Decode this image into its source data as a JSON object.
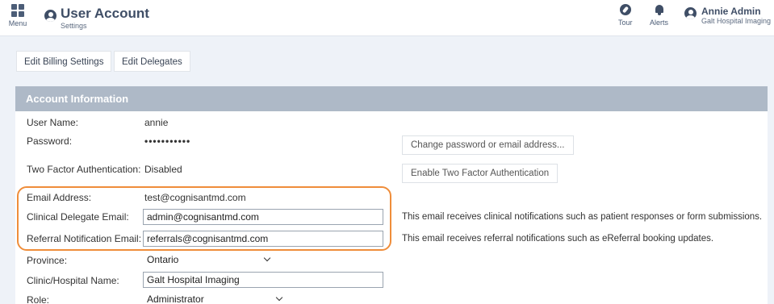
{
  "header": {
    "menu_label": "Menu",
    "title": "User Account",
    "subtitle": "Settings",
    "tour_label": "Tour",
    "alerts_label": "Alerts",
    "user_name": "Annie Admin",
    "user_org": "Galt Hospital Imaging"
  },
  "toolbar": {
    "edit_billing": "Edit Billing Settings",
    "edit_delegates": "Edit Delegates"
  },
  "panel": {
    "title": "Account Information"
  },
  "fields": {
    "username_label": "User Name:",
    "username_value": "annie",
    "password_label": "Password:",
    "password_value": "•••••••••••",
    "change_password_button": "Change password or email address...",
    "twofa_label": "Two Factor Authentication:",
    "twofa_value": "Disabled",
    "enable_twofa_button": "Enable Two Factor Authentication",
    "email_label": "Email Address:",
    "email_value": "test@cognisantmd.com",
    "clinical_label": "Clinical Delegate Email:",
    "clinical_value": "admin@cognisantmd.com",
    "clinical_note": "This email receives clinical notifications such as patient responses or form submissions.",
    "referral_label": "Referral Notification Email:",
    "referral_value": "referrals@cognisantmd.com",
    "referral_note": "This email receives referral notifications such as eReferral booking updates.",
    "province_label": "Province:",
    "province_value": "Ontario",
    "clinic_label": "Clinic/Hospital Name:",
    "clinic_value": "Galt Hospital Imaging",
    "role_label": "Role:",
    "role_value": "Administrator"
  },
  "colors": {
    "highlight": "#ef8d3a",
    "panel_header": "#aeb9c7",
    "background": "#eef2f8"
  },
  "icons": {
    "menu": "grid-icon",
    "title": "user-circle-icon",
    "tour": "compass-icon",
    "alerts": "bell-icon",
    "profile": "user-circle-icon"
  }
}
